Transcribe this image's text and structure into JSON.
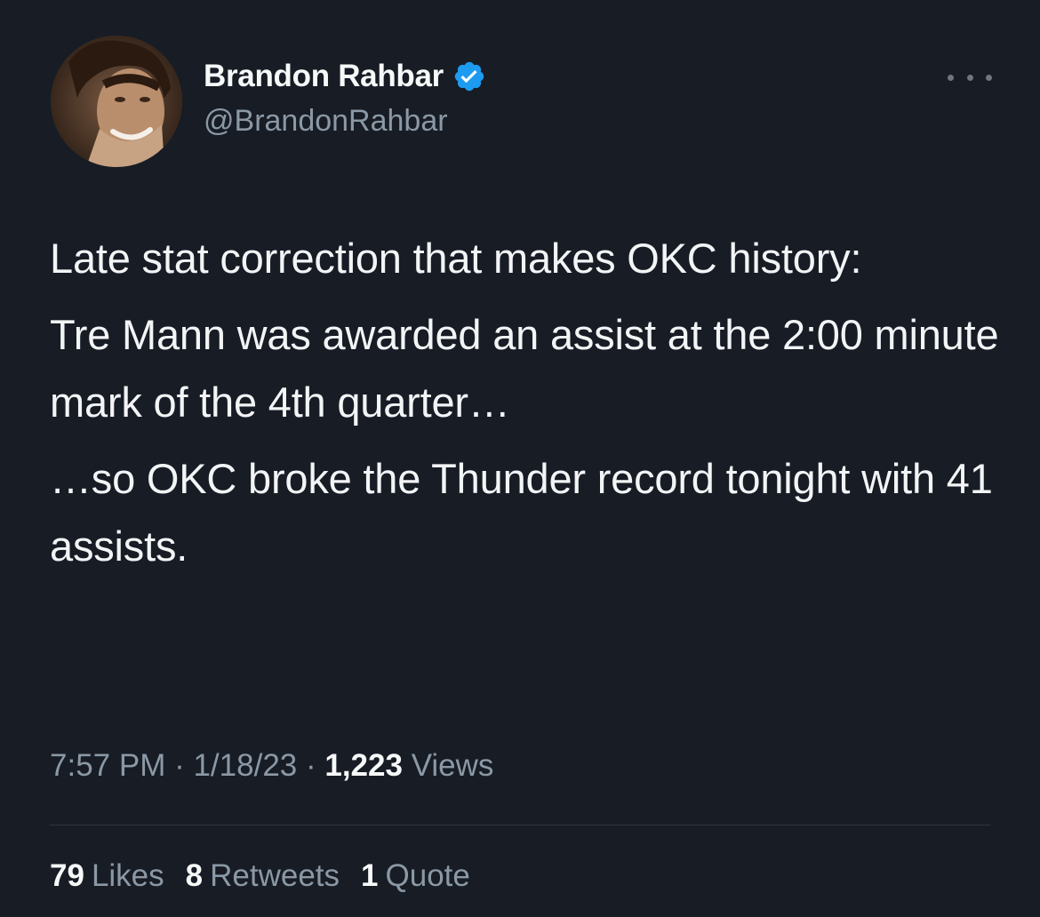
{
  "author": {
    "display_name": "Brandon Rahbar",
    "handle": "@BrandonRahbar",
    "verified": true
  },
  "tweet": {
    "paragraphs": [
      "Late stat correction that makes OKC history:",
      "Tre Mann was awarded an assist at the 2:00 minute mark of the 4th quarter…",
      "…so OKC broke the Thunder record tonight with 41 assists."
    ]
  },
  "meta": {
    "time": "7:57 PM",
    "separator": " · ",
    "date": "1/18/23",
    "views_count": "1,223",
    "views_label": "Views"
  },
  "stats": {
    "likes_count": "79",
    "likes_label": "Likes",
    "retweets_count": "8",
    "retweets_label": "Retweets",
    "quotes_count": "1",
    "quotes_label": "Quote"
  },
  "colors": {
    "background": "#171c25",
    "text_primary": "#f7f9f9",
    "text_secondary": "#8b98a5",
    "verified_badge": "#1d9bf0"
  },
  "icons": {
    "verified": "verified-badge-icon",
    "more": "more-options-icon"
  }
}
